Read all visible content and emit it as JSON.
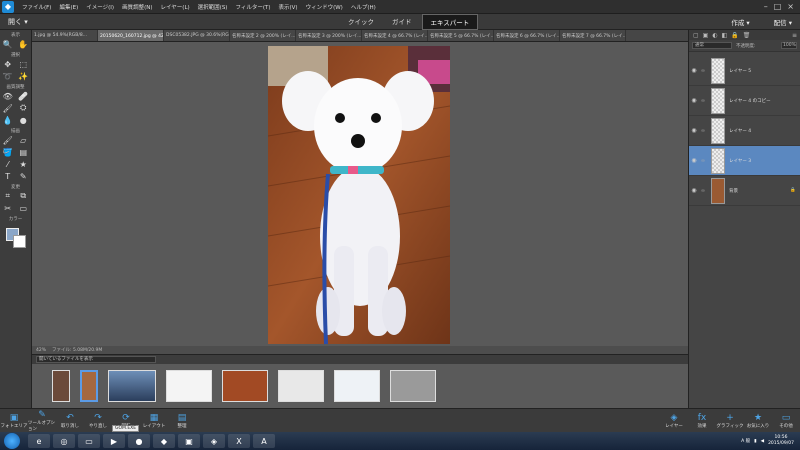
{
  "menubar": {
    "items": [
      "ファイル(F)",
      "編集(E)",
      "イメージ(I)",
      "画質調整(N)",
      "レイヤー(L)",
      "選択範囲(S)",
      "フィルター(T)",
      "表示(V)",
      "ウィンドウ(W)",
      "ヘルプ(H)"
    ]
  },
  "modebar": {
    "open": "開く",
    "tabs": [
      "クイック",
      "ガイド",
      "エキスパート"
    ],
    "create": "作成",
    "share": "配信"
  },
  "tools": {
    "view": "表示",
    "select": "選択",
    "enhance": "画質調整",
    "draw": "描画",
    "modify": "変更",
    "color": "カラー"
  },
  "doctabs": [
    "1.jpg @ 54.9%(RGB/8...",
    "20150620_160712.jpg @ 42% (レイヤー 3, RGB/8) *",
    "DSC05382.JPG @ 30.6%(RG...",
    "名称未設定 2 @ 200% (レイ...",
    "名称未設定 3 @ 200% (レイ...",
    "名称未設定 4 @ 66.7% (レイ...",
    "名称未設定 5 @ 66.7% (レイ...",
    "名称未設定 6 @ 66.7% (レイ...",
    "名称未設定 7 @ 66.7% (レイ..."
  ],
  "status": {
    "zoom": "42%",
    "file": "ファイル: 5.08M/20.9M"
  },
  "bin": {
    "select": "開いているファイルを表示"
  },
  "layers_panel": {
    "blend": "通常",
    "opacity_label": "不透明度:",
    "opacity": "100%",
    "layers": [
      "レイヤー 5",
      "レイヤー 4 のコピー",
      "レイヤー 4",
      "レイヤー 3",
      "背景"
    ]
  },
  "bottom": {
    "left": [
      "フォトエリア",
      "ツールオプション",
      "取り消し",
      "やり直し",
      "回転",
      "レイアウト",
      "整理"
    ],
    "right": [
      "レイヤー",
      "効果",
      "グラフィック",
      "お気に入り",
      "その他"
    ],
    "tooltip": "GOM.EXE"
  },
  "taskbar": {
    "ime": "A 般",
    "time": "10:56",
    "date": "2015/09/07"
  }
}
